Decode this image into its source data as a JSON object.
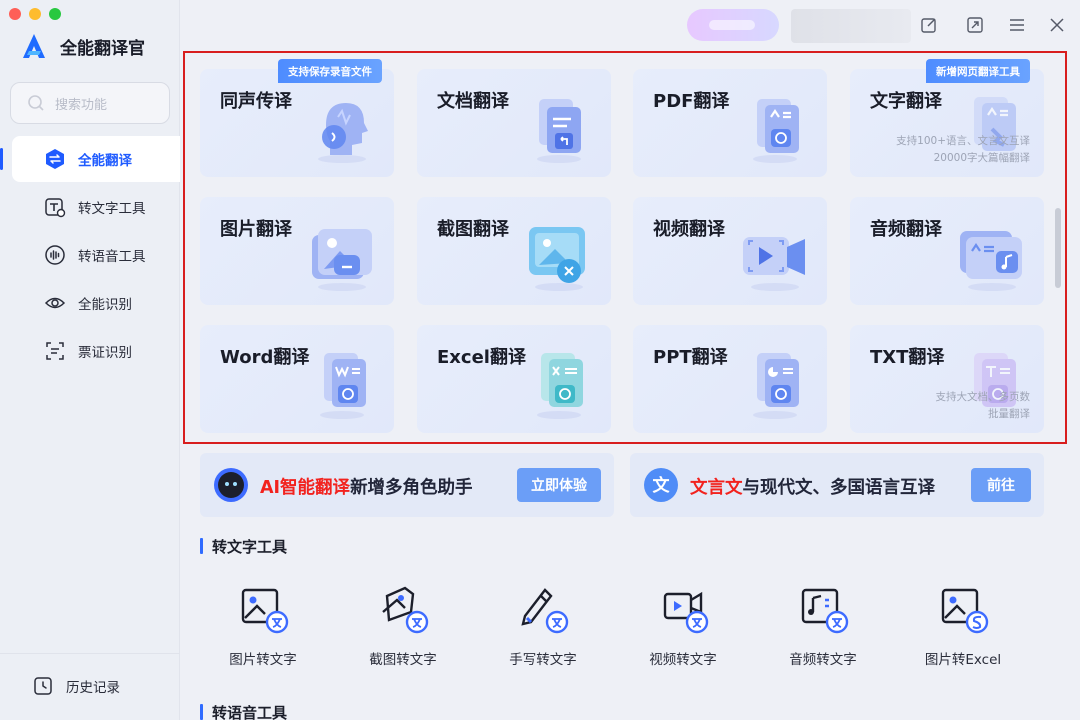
{
  "app": {
    "name": "全能翻译官"
  },
  "search": {
    "placeholder": "搜索功能"
  },
  "sidebar": {
    "items": [
      {
        "label": "全能翻译",
        "icon": "translate-icon",
        "active": true
      },
      {
        "label": "转文字工具",
        "icon": "text-tool-icon",
        "active": false
      },
      {
        "label": "转语音工具",
        "icon": "voice-tool-icon",
        "active": false
      },
      {
        "label": "全能识别",
        "icon": "eye-scan-icon",
        "active": false
      },
      {
        "label": "票证识别",
        "icon": "ticket-scan-icon",
        "active": false
      }
    ],
    "history": "历史记录"
  },
  "cards": [
    {
      "title": "同声传译",
      "badge": "支持保存录音文件",
      "icon": "head-voice-icon"
    },
    {
      "title": "文档翻译",
      "icon": "document-icon"
    },
    {
      "title": "PDF翻译",
      "icon": "pdf-icon"
    },
    {
      "title": "文字翻译",
      "badge": "新增网页翻译工具",
      "desc1": "支持100+语言、文言文互译",
      "desc2": "20000字大篇幅翻译",
      "icon": "text-icon"
    },
    {
      "title": "图片翻译",
      "icon": "image-icon"
    },
    {
      "title": "截图翻译",
      "icon": "screenshot-icon"
    },
    {
      "title": "视频翻译",
      "icon": "video-icon"
    },
    {
      "title": "音频翻译",
      "icon": "audio-icon"
    },
    {
      "title": "Word翻译",
      "icon": "word-icon"
    },
    {
      "title": "Excel翻译",
      "icon": "excel-icon"
    },
    {
      "title": "PPT翻译",
      "icon": "ppt-icon"
    },
    {
      "title": "TXT翻译",
      "desc1": "支持大文档、多页数",
      "desc2": "批量翻译",
      "icon": "txt-icon"
    }
  ],
  "promos": [
    {
      "highlight": "AI智能翻译",
      "rest": "新增多角色助手",
      "button": "立即体验"
    },
    {
      "highlight": "文言文",
      "rest": "与现代文、多国语言互译",
      "button": "前往",
      "icon_text": "文"
    }
  ],
  "sections": {
    "text_tools": "转文字工具",
    "voice_tools": "转语音工具"
  },
  "tools": [
    {
      "label": "图片转文字",
      "icon": "image-to-text-icon"
    },
    {
      "label": "截图转文字",
      "icon": "screenshot-to-text-icon"
    },
    {
      "label": "手写转文字",
      "icon": "handwriting-to-text-icon"
    },
    {
      "label": "视频转文字",
      "icon": "video-to-text-icon"
    },
    {
      "label": "音频转文字",
      "icon": "audio-to-text-icon"
    },
    {
      "label": "图片转Excel",
      "icon": "image-to-excel-icon"
    }
  ],
  "colors": {
    "accent": "#1f5bff",
    "highlight_border": "#d81e1e",
    "promo_red": "#f2221e",
    "badge": "#4e8cff"
  }
}
